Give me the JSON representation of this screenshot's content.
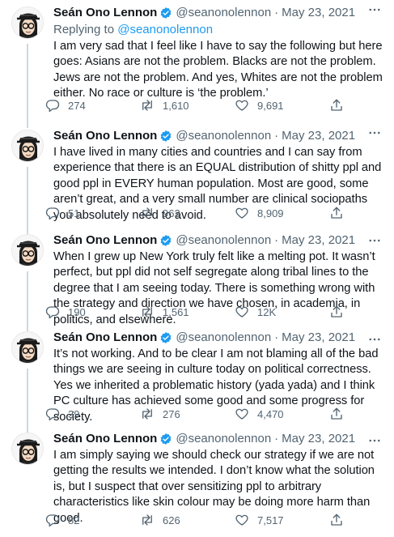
{
  "author": {
    "name": "Seán Ono Lennon",
    "handle": "@seanonolennon",
    "separator": "·",
    "avatar_icon": "cartoon-avatar-icon",
    "verified_icon": "verified-badge-icon"
  },
  "colors": {
    "text": "#0f1419",
    "secondary": "#536471",
    "accent": "#1d9bf0",
    "thread_line": "#cfd9de"
  },
  "tweets": [
    {
      "date": "May 23, 2021",
      "replying_prefix": "Replying to",
      "replying_to": "@seanonolennon",
      "text": "I am very sad that I feel like I have to say the following but here goes: Asians are not the problem. Blacks are not the problem. Jews are not the problem. And yes, Whites are not the problem either. No race or culture is ‘the problem.’",
      "replies": "274",
      "retweets": "1,610",
      "likes": "9,691"
    },
    {
      "date": "May 23, 2021",
      "text": "I have lived in many cities and countries and I can say from experience that there is an EQUAL distribution of shitty ppl and good ppl in EVERY human population. Most are good, some aren’t great, and a very small number are clinical sociopaths you absolutely need to avoid.",
      "replies": "51",
      "retweets": "962",
      "likes": "8,909"
    },
    {
      "date": "May 23, 2021",
      "text": "When I grew up New York truly felt like a melting pot. It wasn’t perfect, but ppl did not self segregate along tribal lines to the degree that I am seeing today. There is something wrong with the strategy and direction we have chosen, in academia, in politics, and elsewhere.",
      "replies": "190",
      "retweets": "1,561",
      "likes": "12K"
    },
    {
      "date": "May 23, 2021",
      "text": "It’s not working. And to be clear I am not blaming all of the bad things we are seeing in culture today on political correctness. Yes we inherited a problematic history (yada yada) and I think PC culture has achieved some good and some progress for society.",
      "replies": "39",
      "retweets": "276",
      "likes": "4,470"
    },
    {
      "date": "May 23, 2021",
      "text": "I am simply saying we should check our strategy if we are not getting the results we intended. I don’t know what the solution is, but I suspect that over sensitizing ppl to arbitrary characteristics like skin colour may be doing more harm than good.",
      "replies": "82",
      "retweets": "626",
      "likes": "7,517"
    }
  ]
}
